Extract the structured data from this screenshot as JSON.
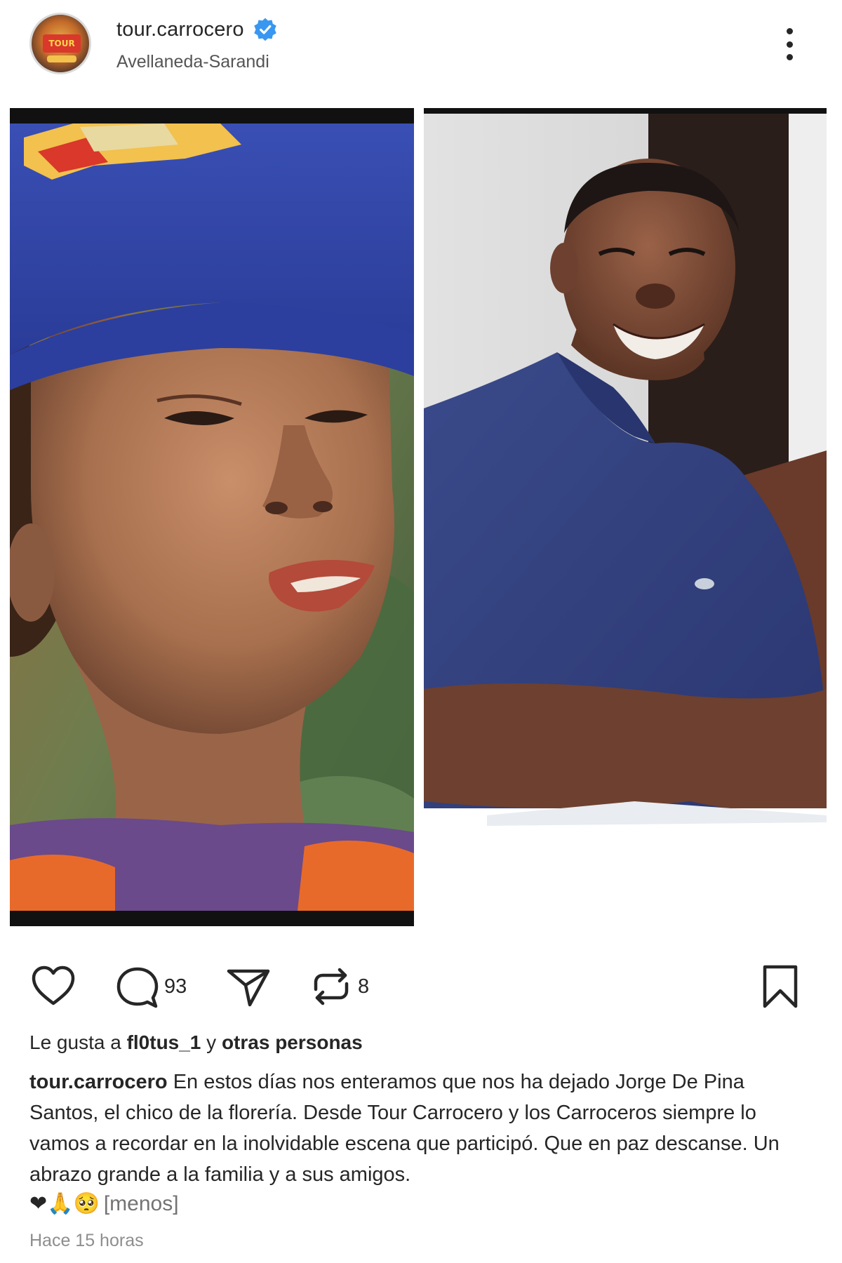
{
  "post": {
    "username": "tour.carrocero",
    "location": "Avellaneda-Sarandi",
    "avatar_text": "TOUR",
    "verified": true
  },
  "actions": {
    "comments_count": "93",
    "reposts_count": "8"
  },
  "likes": {
    "prefix": "Le gusta a",
    "user": "fl0tus_1",
    "middle": "y",
    "suffix": "otras personas"
  },
  "caption": {
    "user": "tour.carrocero",
    "text": "En estos días nos enteramos que nos ha dejado Jorge De Pina Santos, el chico de la florería. Desde Tour Carrocero y los Carroceros siempre lo vamos a recordar en la inolvidable escena que participó. Que en paz descanse. Un abrazo grande a la familia y a sus amigos.",
    "emojis": "❤🙏🥺",
    "less_label": "[menos]"
  },
  "timestamp": "Hace 15 horas",
  "colors": {
    "verified_blue": "#3897f0",
    "text": "#262626",
    "muted": "#8e8e8e"
  },
  "icons": [
    "heart-icon",
    "comment-icon",
    "share-icon",
    "repost-icon",
    "bookmark-icon",
    "more-options-icon",
    "verified-badge-icon"
  ]
}
